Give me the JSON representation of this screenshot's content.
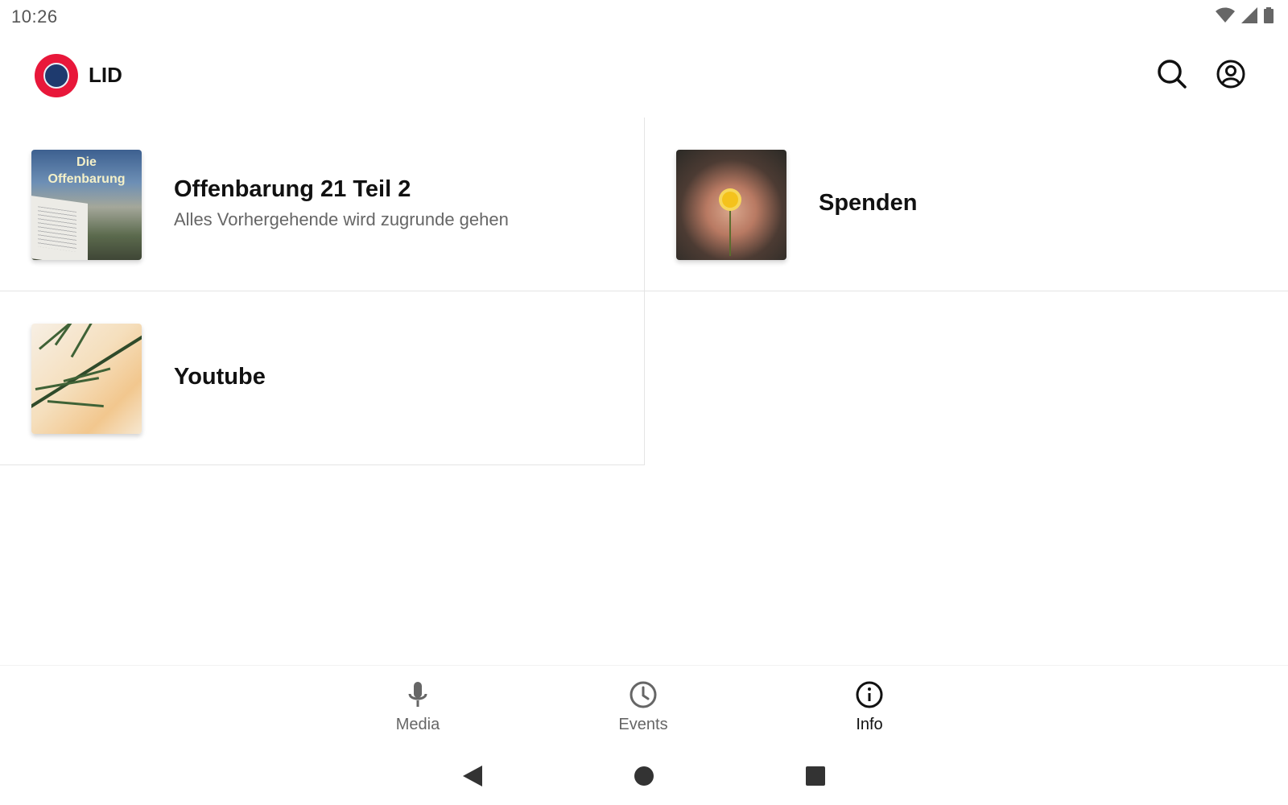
{
  "status_bar": {
    "time": "10:26",
    "icons": [
      "wifi-icon",
      "signal-icon",
      "battery-icon"
    ]
  },
  "app_bar": {
    "title": "LID",
    "logo": "lid-logo",
    "actions": [
      "search-icon",
      "account-icon"
    ]
  },
  "items": [
    {
      "title": "Offenbarung 21  Teil 2",
      "subtitle": "Alles Vorhergehende wird zugrunde gehen",
      "thumb_text_1": "Die",
      "thumb_text_2": "Offenbarung"
    },
    {
      "title": "Spenden",
      "subtitle": ""
    },
    {
      "title": "Youtube",
      "subtitle": ""
    }
  ],
  "bottom_nav": {
    "items": [
      {
        "label": "Media",
        "icon": "microphone-icon"
      },
      {
        "label": "Events",
        "icon": "clock-icon"
      },
      {
        "label": "Info",
        "icon": "info-icon"
      }
    ],
    "active": "Info"
  },
  "system_nav": [
    "back-icon",
    "home-icon",
    "recents-icon"
  ],
  "colors": {
    "brand_red": "#e8173a",
    "text_primary": "#111111",
    "text_secondary": "#666666",
    "divider": "#e4e4e4"
  }
}
